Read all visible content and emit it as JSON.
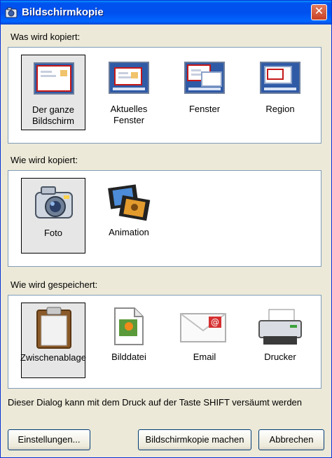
{
  "window": {
    "title": "Bildschirmkopie"
  },
  "sections": {
    "what": {
      "label": "Was wird kopiert:",
      "items": [
        {
          "label": "Der ganze\nBildschirm",
          "icon": "fullscreen-icon"
        },
        {
          "label": "Aktuelles\nFenster",
          "icon": "active-window-icon"
        },
        {
          "label": "Fenster",
          "icon": "window-icon"
        },
        {
          "label": "Region",
          "icon": "region-icon"
        }
      ],
      "selected": "Der ganze\nBildschirm"
    },
    "how": {
      "label": "Wie wird kopiert:",
      "items": [
        {
          "label": "Foto",
          "icon": "camera-icon"
        },
        {
          "label": "Animation",
          "icon": "film-icon"
        }
      ],
      "selected": "Foto"
    },
    "save": {
      "label": "Wie wird gespeichert:",
      "items": [
        {
          "label": "Zwischenablage",
          "icon": "clipboard-icon"
        },
        {
          "label": "Bilddatei",
          "icon": "image-file-icon"
        },
        {
          "label": "Email",
          "icon": "email-icon"
        },
        {
          "label": "Drucker",
          "icon": "printer-icon"
        }
      ],
      "selected": "Zwischenablage"
    }
  },
  "status_text": "Dieser Dialog kann mit dem Druck auf der Taste SHIFT versäumt werden",
  "buttons": {
    "settings": "Einstellungen...",
    "capture": "Bildschirmkopie machen",
    "cancel": "Abbrechen"
  }
}
